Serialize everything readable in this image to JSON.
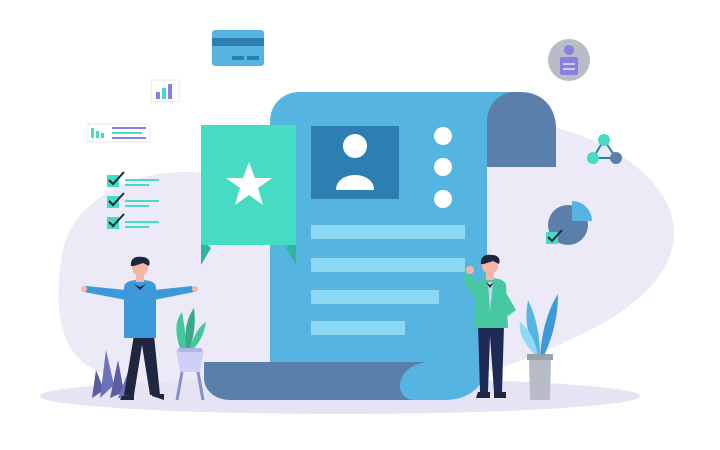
{
  "scene": {
    "subject": "resume-document-illustration",
    "colors": {
      "paper_blue": "#55b4e0",
      "paper_fold": "#5a7fa8",
      "badge_green": "#46dcc4",
      "photo_bg": "#2d7fb2",
      "text_line": "#8cd8f5",
      "blob": "#edeaf8",
      "shirt_blue": "#3d9ad8",
      "shirt_green": "#46c9a0",
      "pants_dark": "#1f2a54",
      "hair_dark": "#1f2640",
      "skin": "#f5b6a5",
      "plant_purple": "#5a5da0",
      "plant_green": "#46c79a",
      "pot_gray": "#9aa3ad"
    },
    "icons": [
      "credit-card-icon",
      "bar-chart-icon",
      "chart-list-icon",
      "checklist-icon",
      "user-avatar-icon",
      "network-nodes-icon",
      "pie-chart-icon",
      "star-icon",
      "profile-photo-icon"
    ],
    "document": {
      "text_lines": 4,
      "bullet_dots": 3
    },
    "checklist": {
      "checked_items": 3
    }
  }
}
